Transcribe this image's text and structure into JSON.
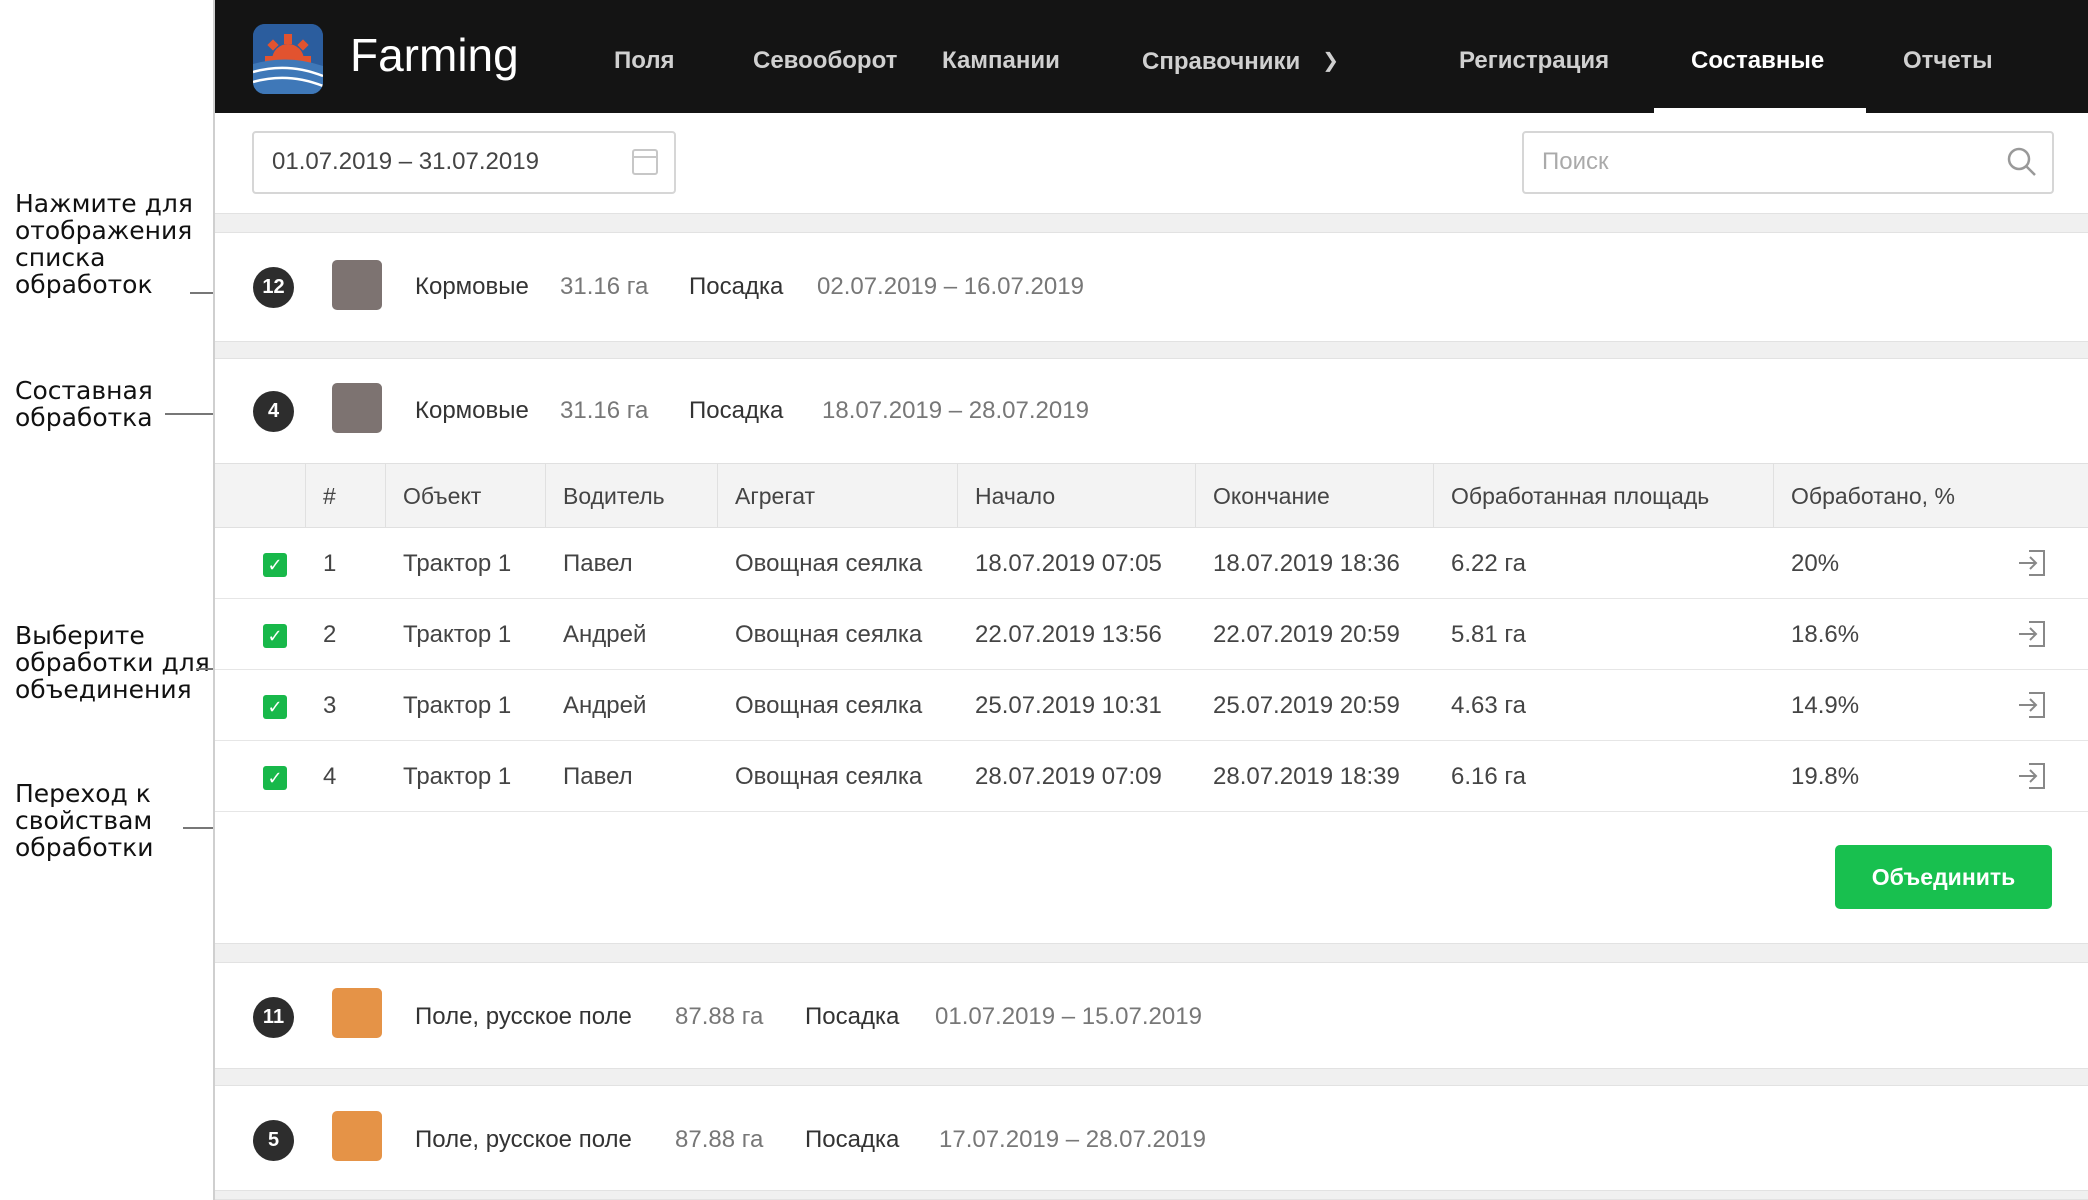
{
  "annotations": [
    "Нажмите для\nотображения\nсписка\nобработок",
    "Составная\nобработка",
    "Выберите\nобработки для\nобъединения",
    "Переход к\nсвойствам\nобработки"
  ],
  "header": {
    "brand": "Farming",
    "nav": [
      "Поля",
      "Севооборот",
      "Кампании",
      "Справочники",
      "Регистрация",
      "Составные",
      "Отчеты"
    ],
    "active": "Составные",
    "dropdown_icon": "chevron-down-icon"
  },
  "filters": {
    "date_range": "01.07.2019 – 31.07.2019",
    "search_placeholder": "Поиск"
  },
  "groups": [
    {
      "count": "12",
      "color": "#7d7371",
      "crop": "Кормовые",
      "area": "31.16 га",
      "operation": "Посадка",
      "period": "02.07.2019 – 16.07.2019"
    },
    {
      "count": "4",
      "color": "#7d7371",
      "crop": "Кормовые",
      "area": "31.16 га",
      "operation": "Посадка",
      "period": "18.07.2019 – 28.07.2019"
    },
    {
      "count": "11",
      "color": "#e59347",
      "crop": "Поле, русское поле",
      "area": "87.88 га",
      "operation": "Посадка",
      "period": "01.07.2019 – 15.07.2019"
    },
    {
      "count": "5",
      "color": "#e59347",
      "crop": "Поле, русское поле",
      "area": "87.88 га",
      "operation": "Посадка",
      "period": "17.07.2019 – 28.07.2019"
    }
  ],
  "table": {
    "columns": [
      "#",
      "Объект",
      "Водитель",
      "Агрегат",
      "Начало",
      "Окончание",
      "Обработанная площадь",
      "Обработано, %"
    ],
    "rows": [
      {
        "n": "1",
        "object": "Трактор 1",
        "driver": "Павел",
        "unit": "Овощная сеялка",
        "start": "18.07.2019 07:05",
        "end": "18.07.2019 18:36",
        "area": "6.22 га",
        "percent": "20%"
      },
      {
        "n": "2",
        "object": "Трактор 1",
        "driver": "Андрей",
        "unit": "Овощная сеялка",
        "start": "22.07.2019 13:56",
        "end": "22.07.2019 20:59",
        "area": "5.81 га",
        "percent": "18.6%"
      },
      {
        "n": "3",
        "object": "Трактор 1",
        "driver": "Андрей",
        "unit": "Овощная сеялка",
        "start": "25.07.2019 10:31",
        "end": "25.07.2019 20:59",
        "area": "4.63 га",
        "percent": "14.9%"
      },
      {
        "n": "4",
        "object": "Трактор 1",
        "driver": "Павел",
        "unit": "Овощная сеялка",
        "start": "28.07.2019 07:09",
        "end": "28.07.2019 18:39",
        "area": "6.16 га",
        "percent": "19.8%"
      }
    ]
  },
  "merge_button": "Объединить",
  "colors": {
    "accent": "#18c04f",
    "topbar": "#141414",
    "badge": "#2d2d2d"
  }
}
